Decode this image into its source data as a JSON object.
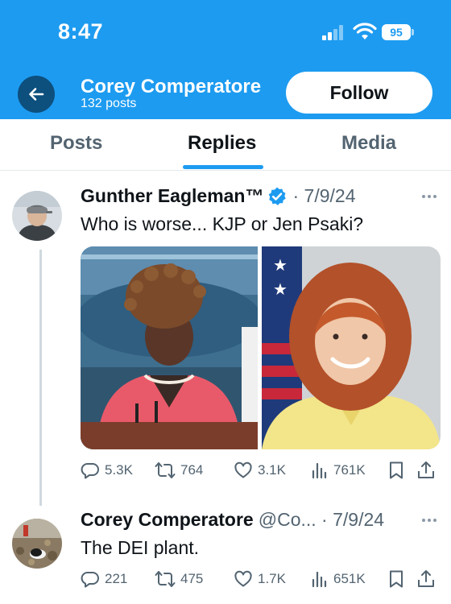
{
  "status_bar": {
    "time": "8:47",
    "battery": "95"
  },
  "header": {
    "profile_name": "Corey Comperatore",
    "post_count": "132 posts",
    "follow_label": "Follow"
  },
  "tabs": [
    {
      "label": "Posts"
    },
    {
      "label": "Replies"
    },
    {
      "label": "Media"
    }
  ],
  "tweets": [
    {
      "author": "Gunther Eagleman™",
      "verified": true,
      "meta": "· 7/9/24",
      "text": "Who is worse... KJP or Jen Psaki?",
      "stats": {
        "replies": "5.3K",
        "reposts": "764",
        "likes": "3.1K",
        "views": "761K"
      }
    },
    {
      "author": "Corey Comperatore",
      "meta": "@Co... · 7/9/24",
      "text": "The DEI plant.",
      "stats": {
        "replies": "221",
        "reposts": "475",
        "likes": "1.7K",
        "views": "651K"
      }
    }
  ],
  "colors": {
    "brand": "#1d9bf0",
    "text": "#0f1419",
    "muted": "#536471"
  },
  "icons": [
    "back-arrow-icon",
    "signal-icon",
    "wifi-icon",
    "battery-icon",
    "verified-badge-icon",
    "more-icon",
    "reply-icon",
    "repost-icon",
    "like-icon",
    "views-icon",
    "bookmark-icon",
    "share-icon"
  ]
}
